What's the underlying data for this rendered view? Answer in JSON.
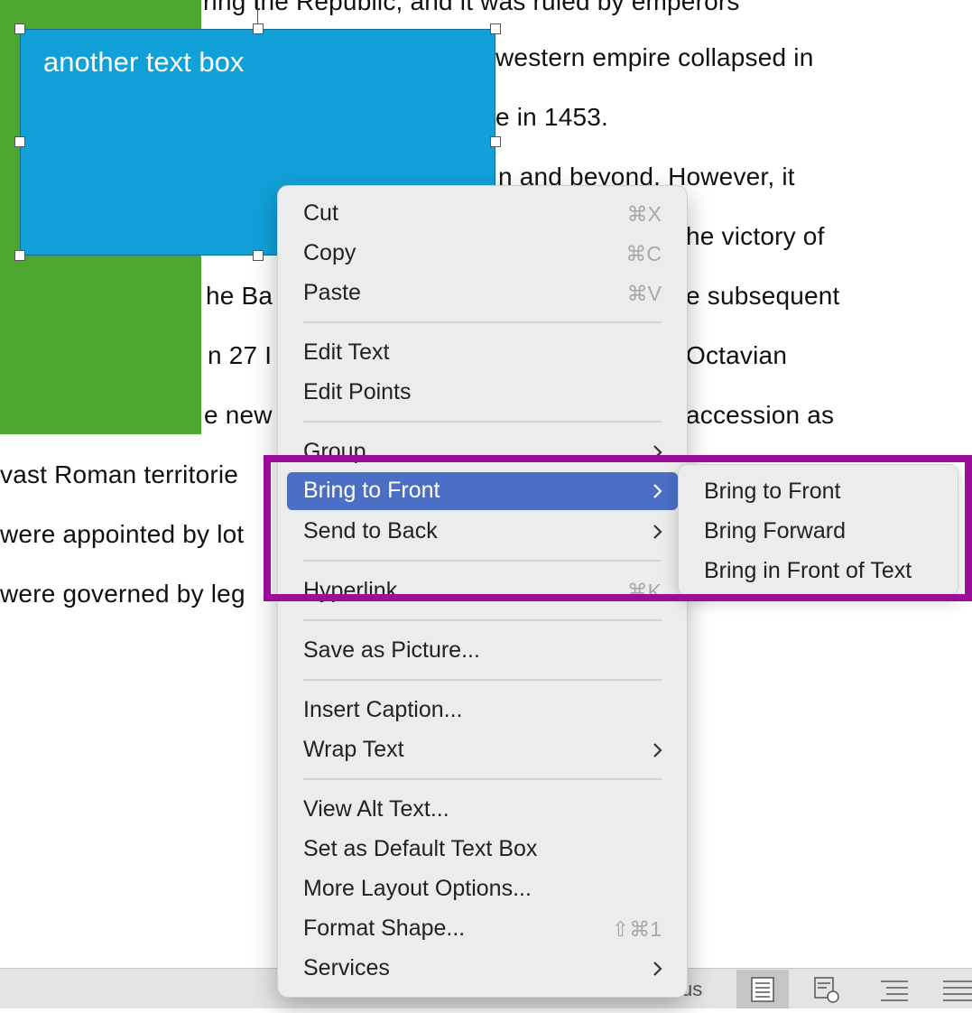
{
  "document": {
    "lines": [
      "ring the Republic, and it was ruled by emperors",
      "western empire collapsed in",
      "e in 1453.",
      "n and beyond. However, it",
      "he victory of",
      "he Ba",
      "e subsequent",
      "n 27 I",
      "Octavian",
      "e new",
      "accession as",
      "vast Roman territorie",
      "were appointed by lot",
      "were governed by leg"
    ],
    "text_box_label": "another text box"
  },
  "context_menu": {
    "items": [
      {
        "label": "Cut",
        "shortcut": "⌘X"
      },
      {
        "label": "Copy",
        "shortcut": "⌘C"
      },
      {
        "label": "Paste",
        "shortcut": "⌘V"
      },
      {
        "label": "Edit Text"
      },
      {
        "label": "Edit Points"
      },
      {
        "label": "Group"
      },
      {
        "label": "Bring to Front"
      },
      {
        "label": "Send to Back"
      },
      {
        "label": "Hyperlink",
        "shortcut": "⌘K"
      },
      {
        "label": "Save as Picture..."
      },
      {
        "label": "Insert Caption..."
      },
      {
        "label": "Wrap Text"
      },
      {
        "label": "View Alt Text..."
      },
      {
        "label": "Set as Default Text Box"
      },
      {
        "label": "More Layout Options..."
      },
      {
        "label": "Format Shape...",
        "shortcut": "⇧⌘1"
      },
      {
        "label": "Services"
      }
    ]
  },
  "submenu": {
    "items": [
      {
        "label": "Bring to Front"
      },
      {
        "label": "Bring Forward"
      },
      {
        "label": "Bring in Front of Text"
      }
    ]
  },
  "status_bar": {
    "text": "us"
  },
  "colors": {
    "green_shape": "#4da832",
    "text_box_fill": "#11a0d8",
    "menu_highlight": "#4b6fc5",
    "annotation_frame": "#9b0e9b"
  }
}
